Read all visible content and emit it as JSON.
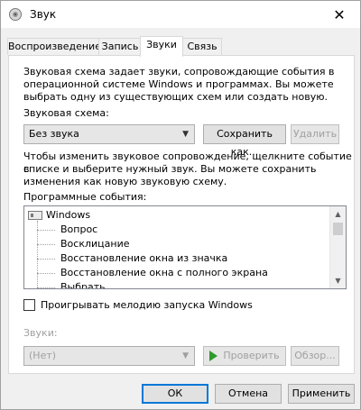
{
  "window": {
    "title": "Звук"
  },
  "tabs": [
    "Воспроизведение",
    "Запись",
    "Звуки",
    "Связь"
  ],
  "intro_text": [
    "Звуковая схема задает звуки, сопровождающие события в",
    "операционной системе Windows и программах. Вы можете",
    "выбрать одну из существующих схем или создать новую."
  ],
  "scheme": {
    "label": "Звуковая схема:",
    "value": "Без звука",
    "save_label": "Сохранить как...",
    "delete_label": "Удалить"
  },
  "change_text": [
    "Чтобы изменить звуковое сопровождение, щелкните событие в",
    "списке и выберите нужный звук. Вы можете сохранить",
    "изменения как новую звуковую схему."
  ],
  "events": {
    "label": "Программные события:",
    "root": "Windows",
    "items": [
      "Вопрос",
      "Восклицание",
      "Восстановление окна из значка",
      "Восстановление окна с полного экрана",
      "Выбрать"
    ]
  },
  "startup_checkbox": {
    "label": "Проигрывать мелодию запуска Windows",
    "checked": false
  },
  "sounds": {
    "label": "Звуки:",
    "value": "(Нет)",
    "test_label": "Проверить",
    "browse_label": "Обзор..."
  },
  "footer": {
    "ok": "ОК",
    "cancel": "Отмена",
    "apply": "Применить"
  }
}
